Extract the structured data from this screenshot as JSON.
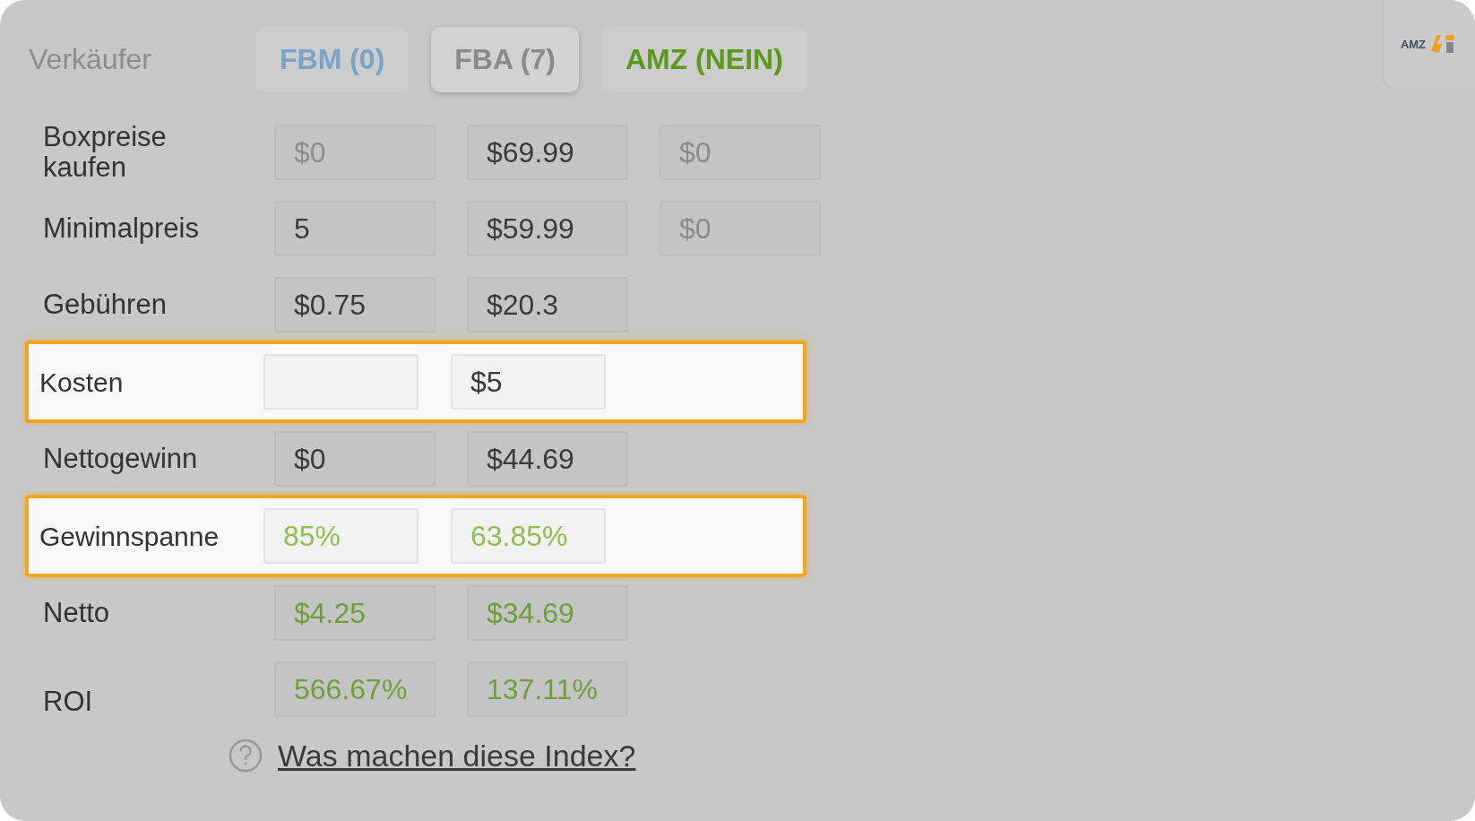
{
  "seller_label": "Verkäufer",
  "tabs": [
    {
      "label": "FBM (0)",
      "selected": false,
      "color": "#7ba3c8"
    },
    {
      "label": "FBA (7)",
      "selected": true,
      "color": "#8a8a8a"
    },
    {
      "label": "AMZ (NEIN)",
      "selected": false,
      "color": "#5c9a1e"
    }
  ],
  "logo": {
    "text": "AMZ"
  },
  "rows": [
    {
      "label": "Boxpreise kaufen",
      "highlighted": false,
      "cells": [
        {
          "value": "$0",
          "kind": "muted"
        },
        {
          "value": "$69.99",
          "kind": "normal"
        },
        {
          "value": "$0",
          "kind": "muted"
        }
      ]
    },
    {
      "label": "Minimalpreis",
      "highlighted": false,
      "cells": [
        {
          "value": "5",
          "kind": "normal"
        },
        {
          "value": "$59.99",
          "kind": "normal"
        },
        {
          "value": "$0",
          "kind": "muted"
        }
      ]
    },
    {
      "label": "Gebühren",
      "highlighted": false,
      "cells": [
        {
          "value": "$0.75",
          "kind": "normal"
        },
        {
          "value": "$20.3",
          "kind": "normal"
        }
      ]
    },
    {
      "label": "Kosten",
      "highlighted": true,
      "cells": [
        {
          "kind": "normal"
        },
        {
          "value": "$5",
          "kind": "normal"
        }
      ]
    },
    {
      "label": "Nettogewinn",
      "highlighted": false,
      "cells": [
        {
          "value": "$0",
          "kind": "normal"
        },
        {
          "value": "$44.69",
          "kind": "normal"
        }
      ]
    },
    {
      "label": "Gewinnspanne",
      "highlighted": true,
      "cells": [
        {
          "value": "85%",
          "kind": "profit"
        },
        {
          "value": "63.85%",
          "kind": "profit"
        }
      ]
    },
    {
      "label": "Netto",
      "highlighted": false,
      "cells": [
        {
          "value": "$4.25",
          "kind": "profit"
        },
        {
          "value": "$34.69",
          "kind": "profit"
        }
      ]
    },
    {
      "label": "ROI",
      "highlighted": false,
      "cells": [
        {
          "value": "566.67%",
          "kind": "profit"
        },
        {
          "value": "137.11%",
          "kind": "profit"
        }
      ]
    }
  ],
  "help_link": "Was machen diese Index?"
}
